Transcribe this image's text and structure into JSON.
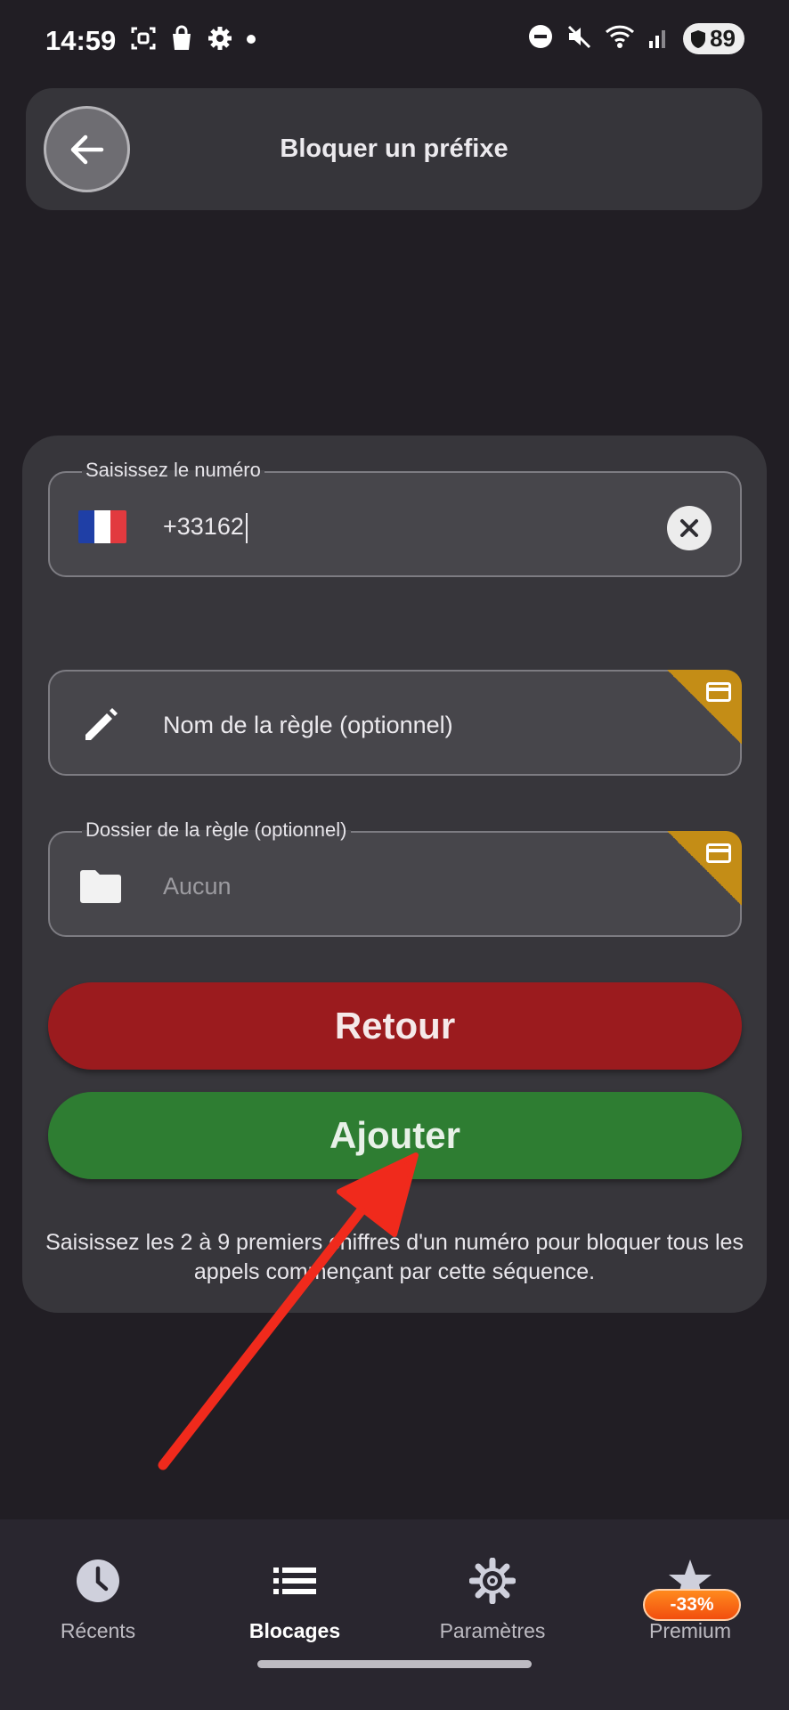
{
  "status_bar": {
    "time": "14:59",
    "battery": "89",
    "left_icons": [
      "screenshot-icon",
      "shopping-bag-icon",
      "settings-gear-icon",
      "dot-icon"
    ],
    "right_icons": [
      "do-not-disturb-icon",
      "mute-icon",
      "wifi-6e-icon",
      "signal-icon",
      "battery-shield-icon"
    ]
  },
  "header": {
    "title": "Bloquer un préfixe",
    "back_icon": "arrow-left-icon"
  },
  "form": {
    "number_field": {
      "label": "Saisissez le numéro",
      "value": "+33162",
      "flag": "france-flag-icon",
      "clear_icon": "close-icon"
    },
    "rule_name_field": {
      "placeholder": "Nom de la règle (optionnel)",
      "icon": "pencil-icon",
      "badge_icon": "premium-card-icon"
    },
    "folder_field": {
      "label": "Dossier de la règle (optionnel)",
      "value": "Aucun",
      "icon": "folder-icon",
      "badge_icon": "premium-card-icon"
    },
    "back_button": "Retour",
    "add_button": "Ajouter",
    "hint": "Saisissez les 2 à 9 premiers chiffres d'un numéro pour bloquer tous les appels commençant par cette séquence."
  },
  "colors": {
    "background": "#211e24",
    "card": "#37363b",
    "retour": "#9b1b1e",
    "ajouter": "#2e7d32",
    "premium_badge": "#c48d16",
    "arrow": "#f02a1c"
  },
  "bottom_nav": {
    "items": [
      {
        "label": "Récents",
        "icon": "clock-icon",
        "active": false
      },
      {
        "label": "Blocages",
        "icon": "list-icon",
        "active": true
      },
      {
        "label": "Paramètres",
        "icon": "gear-icon",
        "active": false
      },
      {
        "label": "Premium",
        "icon": "star-icon",
        "active": false
      }
    ],
    "premium_discount": "-33%"
  }
}
